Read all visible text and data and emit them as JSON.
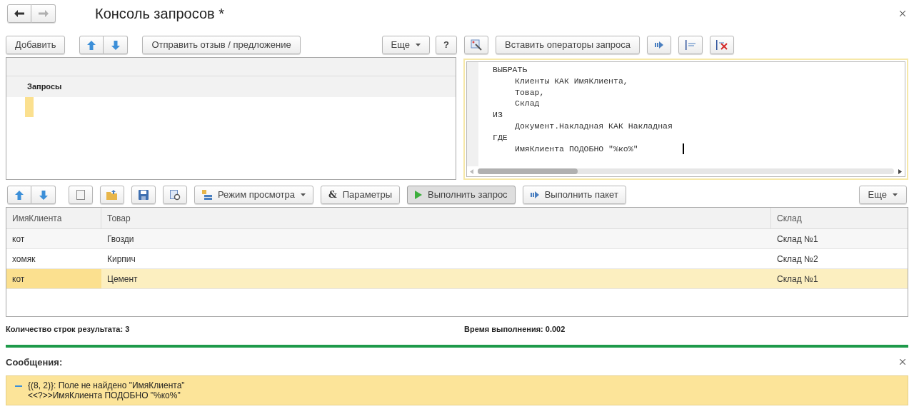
{
  "nav": [
    {
      "kind": "back",
      "disabled": false
    },
    {
      "kind": "forward",
      "disabled": true
    }
  ],
  "window": {
    "title": "Консоль запросов *"
  },
  "top_toolbar": {
    "add": "Добавить",
    "feedback": "Отправить отзыв / предложение",
    "more": "Еще",
    "help": "?"
  },
  "editor_toolbar": {
    "insert": "Вставить операторы запроса"
  },
  "queries": {
    "header": "Запросы",
    "rows": [
      {
        "selected": true
      }
    ]
  },
  "code": [
    {
      "text": "ВЫБРАТЬ",
      "children": [
        {
          "text": "Клиенты КАК ИмяКлиента,"
        },
        {
          "text": "Товар,"
        },
        {
          "text": "Склад"
        }
      ]
    },
    {
      "text": "ИЗ",
      "children": [
        {
          "text": "Документ.Накладная КАК Накладная"
        }
      ]
    },
    {
      "text": "ГДЕ",
      "children": [
        {
          "text": "ИмяКлиента ПОДОБНО \"%ко%\""
        }
      ]
    }
  ],
  "result_toolbar": [
    {
      "kind": "mode",
      "label": "Режим просмотра",
      "pressed": false
    },
    {
      "kind": "params",
      "icon": "&",
      "label": "Параметры",
      "pressed": false
    },
    {
      "kind": "run",
      "label": "Выполнить запрос",
      "pressed": true
    },
    {
      "kind": "batch",
      "label": "Выполнить пакет",
      "pressed": false
    }
  ],
  "result_more": "Еще",
  "table": {
    "columns": [
      "ИмяКлиента",
      "Товар",
      "Склад"
    ],
    "rows": [
      {
        "cells": [
          "кот",
          "Гвозди",
          "Склад №1"
        ],
        "selected": false
      },
      {
        "cells": [
          "хомяк",
          "Кирпич",
          "Склад №2"
        ],
        "selected": false
      },
      {
        "cells": [
          "кот",
          "Цемент",
          "Склад №1"
        ],
        "selected": true
      }
    ]
  },
  "status": {
    "rows": "Количество строк результата: 3",
    "time": "Время выполнения: 0.002"
  },
  "messages": {
    "title": "Сообщения:",
    "items": [
      {
        "lines": [
          "{(8, 2)}: Поле не найдено \"ИмяКлиента\"",
          "<<?>>ИмяКлиента ПОДОБНО \"%ко%\""
        ]
      }
    ]
  }
}
